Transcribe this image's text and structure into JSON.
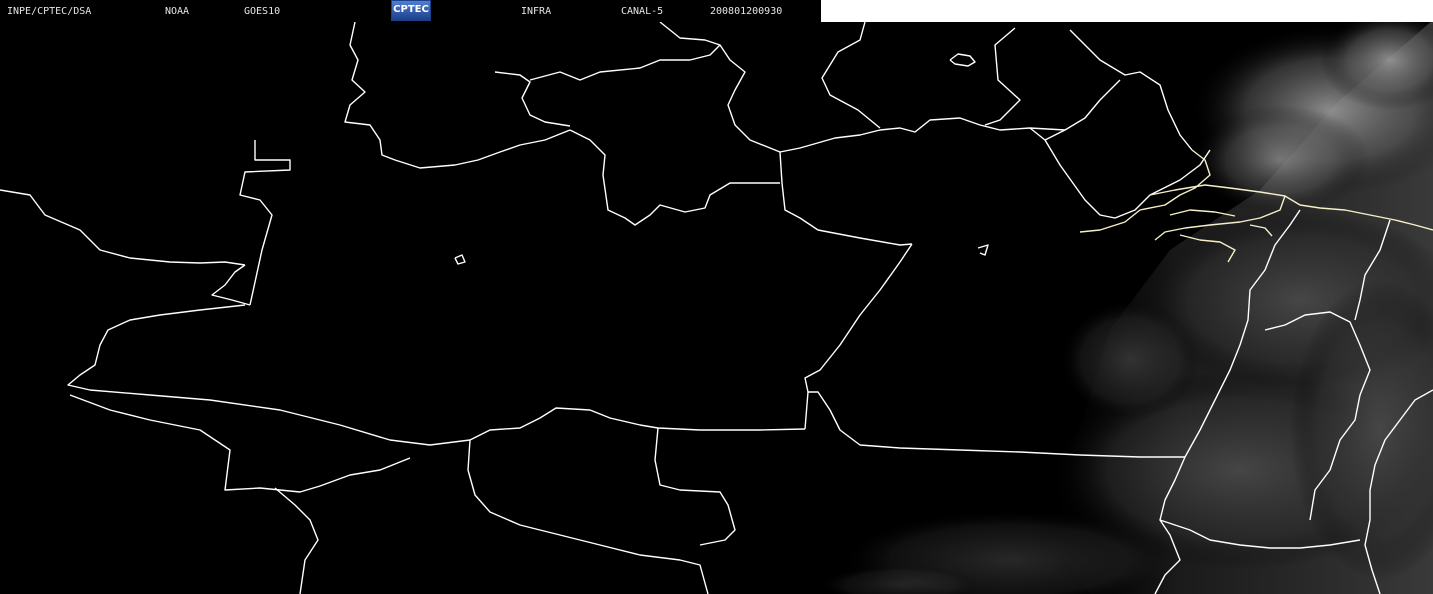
{
  "header": {
    "institution": "INPE/CPTEC/DSA",
    "agency": "NOAA",
    "satellite": "GOES10",
    "logo_text": "CPTEC",
    "band": "INFRA",
    "channel": "CANAL-5",
    "timestamp": "200801200930"
  },
  "colors": {
    "background": "#000000",
    "border_lines": "#ffffff",
    "coastline": "#f5f0c8",
    "logo_blue": "#1d3f8a"
  }
}
